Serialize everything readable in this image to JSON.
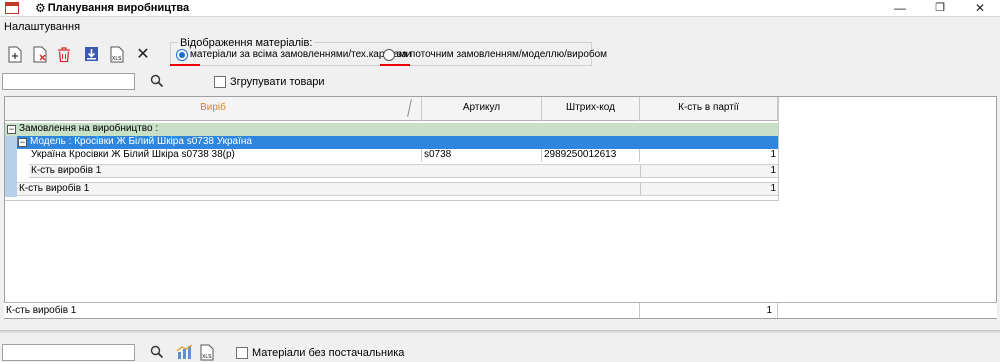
{
  "window": {
    "title": "Планування виробництва",
    "restore_glyph": "❐",
    "close_glyph": "✕",
    "minimize_glyph": "—"
  },
  "menu": {
    "settings": "Налаштування"
  },
  "toolbar": {
    "icons": [
      "add-doc-icon",
      "delete-doc-icon",
      "trash-icon",
      "download-icon",
      "xls-icon",
      "close-icon"
    ],
    "xls_label": "XLS",
    "close_glyph": "✕"
  },
  "materials_display": {
    "title": "Відображення матеріалів:",
    "option_all": "матеріали за всіма замовленнями/тех.картками",
    "option_current": "за поточним замовленням/моделлю/виробом",
    "selected": "option_all"
  },
  "filter": {
    "search_value": "",
    "group_goods_label": "Згрупувати товари",
    "group_goods_checked": false
  },
  "grid": {
    "columns": [
      "Виріб",
      "Артикул",
      "Штрих-код",
      "К-сть в партії"
    ],
    "group_label": "Замовлення на виробництво :",
    "model_label": "Модель : Кросівки Ж Білий Шкіра s0738 Україна",
    "rows": [
      {
        "name": "Україна Кросівки Ж Білий Шкіра s0738 38(р)",
        "article": "s0738",
        "barcode": "2989250012613",
        "qty": "1"
      }
    ],
    "model_total_label": "К-сть виробів 1",
    "model_total_qty": "1",
    "group_total_label": "К-сть виробів 1",
    "group_total_qty": "1",
    "footer_label": "К-сть виробів  1",
    "footer_qty": "1"
  },
  "bottom": {
    "search_value": "",
    "suppliers_label": "Матеріали без постачальника",
    "xls_label": "XLS"
  },
  "colors": {
    "group_row": "#c8dfc8",
    "model_row": "#2e86de",
    "model_side": "#b7d0ea",
    "accent_header": "#d9822b",
    "red_underline": "#e00000"
  }
}
